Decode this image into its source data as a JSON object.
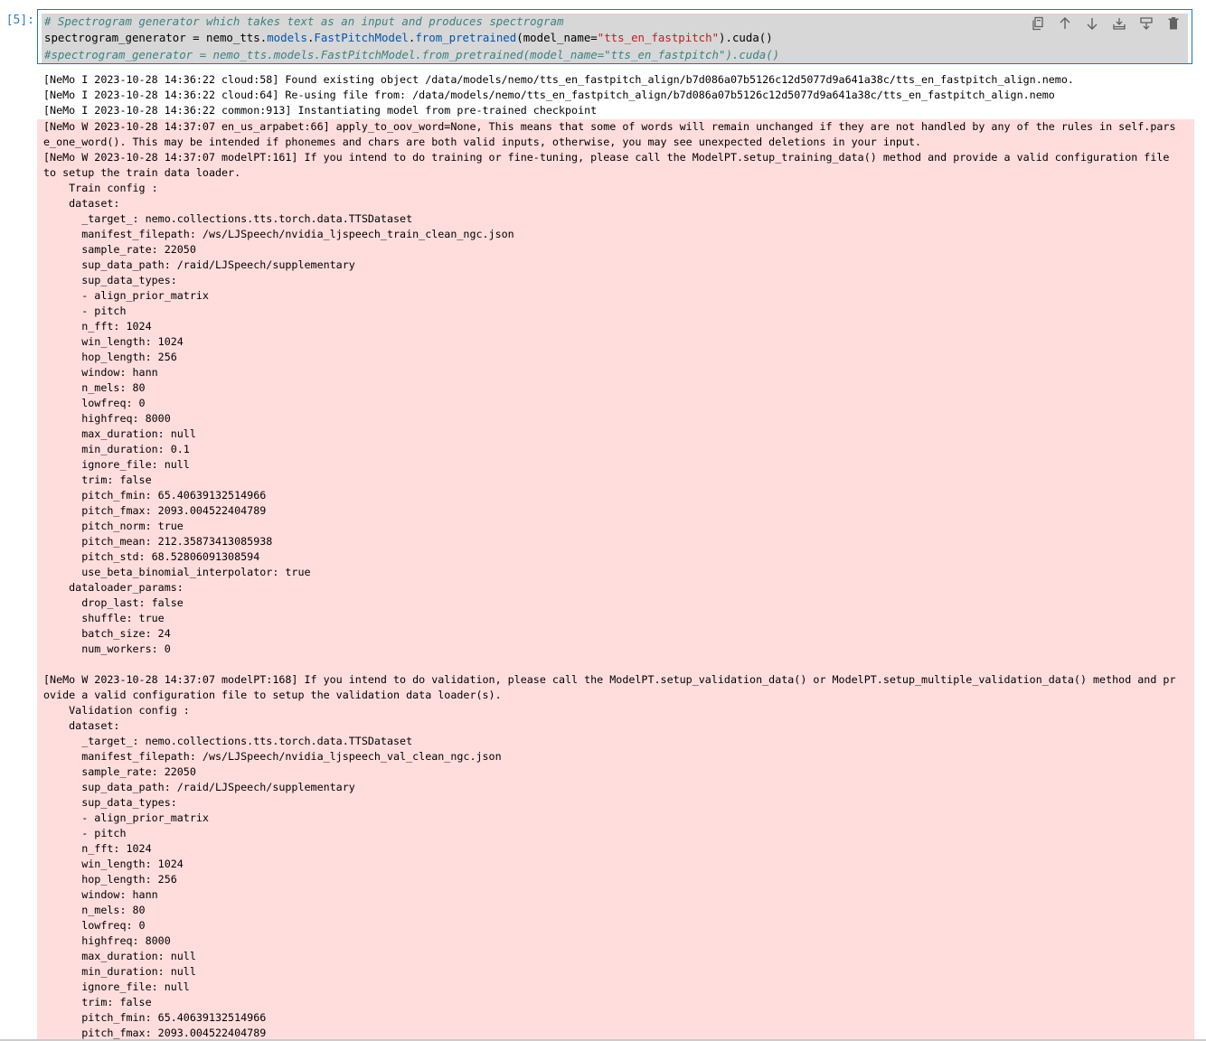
{
  "cell": {
    "prompt": "[5]:",
    "code": {
      "line1": "# Spectrogram generator which takes text as an input and produces spectrogram",
      "line2_parts": {
        "a": "spectrogram_generator = nemo_tts.",
        "b": "models",
        "c": ".",
        "d": "FastPitchModel",
        "e": ".",
        "f": "from_pretrained",
        "g": "(model_name=",
        "h": "\"tts_en_fastpitch\"",
        "i": ").cuda()"
      },
      "line3": "#spectrogram_generator = nemo_tts.models.FastPitchModel.from_pretrained(model_name=\"tts_en_fastpitch\").cuda()"
    },
    "toolbar": {
      "copy": "copy-icon",
      "up": "arrow-up-icon",
      "down": "arrow-down-icon",
      "insert_above": "insert-above-icon",
      "insert_below": "insert-below-icon",
      "delete": "trash-icon"
    }
  },
  "output": {
    "stdout": [
      "[NeMo I 2023-10-28 14:36:22 cloud:58] Found existing object /data/models/nemo/tts_en_fastpitch_align/b7d086a07b5126c12d5077d9a641a38c/tts_en_fastpitch_align.nemo.",
      "[NeMo I 2023-10-28 14:36:22 cloud:64] Re-using file from: /data/models/nemo/tts_en_fastpitch_align/b7d086a07b5126c12d5077d9a641a38c/tts_en_fastpitch_align.nemo",
      "[NeMo I 2023-10-28 14:36:22 common:913] Instantiating model from pre-trained checkpoint"
    ],
    "stderr": [
      "[NeMo W 2023-10-28 14:37:07 en_us_arpabet:66] apply_to_oov_word=None, This means that some of words will remain unchanged if they are not handled by any of the rules in self.pars",
      "e_one_word(). This may be intended if phonemes and chars are both valid inputs, otherwise, you may see unexpected deletions in your input.",
      "[NeMo W 2023-10-28 14:37:07 modelPT:161] If you intend to do training or fine-tuning, please call the ModelPT.setup_training_data() method and provide a valid configuration file",
      "to setup the train data loader.",
      "    Train config :",
      "    dataset:",
      "      _target_: nemo.collections.tts.torch.data.TTSDataset",
      "      manifest_filepath: /ws/LJSpeech/nvidia_ljspeech_train_clean_ngc.json",
      "      sample_rate: 22050",
      "      sup_data_path: /raid/LJSpeech/supplementary",
      "      sup_data_types:",
      "      - align_prior_matrix",
      "      - pitch",
      "      n_fft: 1024",
      "      win_length: 1024",
      "      hop_length: 256",
      "      window: hann",
      "      n_mels: 80",
      "      lowfreq: 0",
      "      highfreq: 8000",
      "      max_duration: null",
      "      min_duration: 0.1",
      "      ignore_file: null",
      "      trim: false",
      "      pitch_fmin: 65.40639132514966",
      "      pitch_fmax: 2093.004522404789",
      "      pitch_norm: true",
      "      pitch_mean: 212.35873413085938",
      "      pitch_std: 68.52806091308594",
      "      use_beta_binomial_interpolator: true",
      "    dataloader_params:",
      "      drop_last: false",
      "      shuffle: true",
      "      batch_size: 24",
      "      num_workers: 0",
      "",
      "[NeMo W 2023-10-28 14:37:07 modelPT:168] If you intend to do validation, please call the ModelPT.setup_validation_data() or ModelPT.setup_multiple_validation_data() method and pr",
      "ovide a valid configuration file to setup the validation data loader(s).",
      "    Validation config :",
      "    dataset:",
      "      _target_: nemo.collections.tts.torch.data.TTSDataset",
      "      manifest_filepath: /ws/LJSpeech/nvidia_ljspeech_val_clean_ngc.json",
      "      sample_rate: 22050",
      "      sup_data_path: /raid/LJSpeech/supplementary",
      "      sup_data_types:",
      "      - align_prior_matrix",
      "      - pitch",
      "      n_fft: 1024",
      "      win_length: 1024",
      "      hop_length: 256",
      "      window: hann",
      "      n_mels: 80",
      "      lowfreq: 0",
      "      highfreq: 8000",
      "      max_duration: null",
      "      min_duration: null",
      "      ignore_file: null",
      "      trim: false",
      "      pitch_fmin: 65.40639132514966",
      "      pitch_fmax: 2093.004522404789"
    ]
  }
}
